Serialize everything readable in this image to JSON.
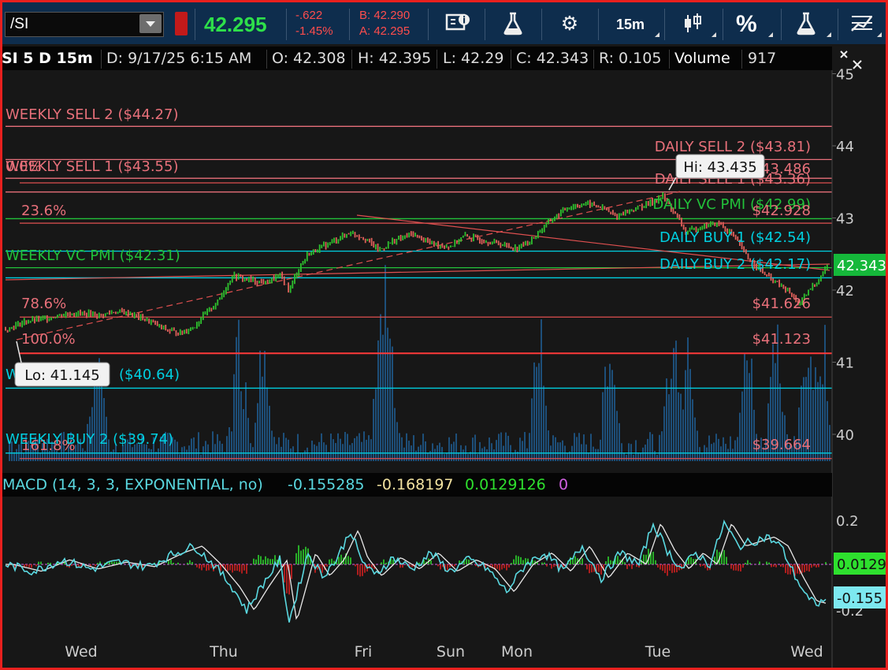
{
  "toolbar": {
    "symbol": "/SI",
    "last": "42.295",
    "change": "-.622",
    "change_pct": "-1.45%",
    "bid": "B: 42.290",
    "ask": "A: 42.295",
    "timeframe": "15m",
    "percent": "%",
    "icons": [
      "symbol-dropdown-icon",
      "link-icon",
      "info-icon",
      "flask-icon",
      "gear-icon",
      "timeframe",
      "candle-style-icon",
      "percent-icon",
      "flask-icon",
      "drawings-icon"
    ]
  },
  "infobar": {
    "symbol": "/SI 5 D 15m",
    "date": "D: 9/17/25 6:15 AM",
    "open": "O: 42.308",
    "high": "H: 42.395",
    "low": "L: 42.29",
    "close": "C: 42.343",
    "range": "R: 0.105",
    "volume_label": "Volume",
    "volume": "917"
  },
  "price_axis": {
    "ticks": [
      "45",
      "44",
      "43",
      "42",
      "41",
      "40"
    ],
    "current": "42.343"
  },
  "levels": {
    "weekly_sell_2": "WEEKLY SELL 2 ($44.27)",
    "weekly_sell_1": "WEEKLY SELL 1 ($43.55)",
    "weekly_vc_pmi": "WEEKLY VC PMI ($42.31)",
    "weekly_buy_1_partial": "W",
    "weekly_buy_1_value": "($40.64)",
    "weekly_buy_2": "WEEKLY BUY 2 ($39.74)",
    "daily_sell_2": "DAILY SELL 2 ($43.81)",
    "daily_sell_1": "DAILY SELL 1 ($43.36)",
    "daily_vc_pmi": "DAILY VC PMI ($42.99)",
    "daily_buy_1": "DAILY BUY 1 ($42.54)",
    "daily_buy_2": "DAILY BUY 2 ($42.17)"
  },
  "fib": {
    "f0": "0.0%",
    "f236": "23.6%",
    "f786": "78.6%",
    "f100": "100.0%",
    "f1618": "161.8%",
    "p0": "$43.486",
    "p236": "$42.928",
    "p786": "$41.626",
    "p100": "$41.123",
    "p1618": "$39.664"
  },
  "callouts": {
    "hi": "Hi: 43.435",
    "lo": "Lo: 41.145"
  },
  "macd": {
    "title": "MACD (14, 3, 3, EXPONENTIAL, no)",
    "value": "-0.155285",
    "avg": "-0.168197",
    "diff": "0.0129126",
    "zero": "0",
    "axis_ticks": [
      "0.2",
      "-0.2"
    ],
    "diff_tag": "0.0129",
    "value_tag": "-0.155"
  },
  "time_axis": [
    "Wed",
    "Thu",
    "Fri",
    "Sun",
    "Mon",
    "Tue",
    "Wed"
  ],
  "colors": {
    "up": "#2ec12e",
    "down": "#e0605a",
    "sell": "#e8707a",
    "buy": "#00cfe0",
    "pmi": "#22c23a",
    "macd": "#5ad8e0",
    "frame": "#e8201e"
  },
  "chart_data": {
    "type": "candlestick",
    "symbol": "/SI",
    "timeframe": "5 D 15m",
    "xlabel": "",
    "ylabel": "",
    "ylim": [
      39.6,
      45.0
    ],
    "x_ticks": [
      "Wed",
      "Thu",
      "Fri",
      "Sun",
      "Mon",
      "Tue",
      "Wed"
    ],
    "close_path": [
      [
        0,
        41.45
      ],
      [
        0.2,
        41.56
      ],
      [
        0.4,
        41.6
      ],
      [
        0.6,
        41.66
      ],
      [
        0.75,
        41.68
      ],
      [
        1.0,
        41.65
      ],
      [
        1.15,
        41.7
      ],
      [
        1.3,
        41.68
      ],
      [
        1.55,
        41.55
      ],
      [
        1.7,
        41.45
      ],
      [
        1.85,
        41.4
      ],
      [
        2.0,
        41.5
      ],
      [
        2.1,
        41.65
      ],
      [
        2.25,
        41.85
      ],
      [
        2.4,
        42.2
      ],
      [
        2.55,
        42.15
      ],
      [
        2.75,
        42.1
      ],
      [
        2.9,
        42.2
      ],
      [
        3.0,
        42.0
      ],
      [
        3.1,
        42.3
      ],
      [
        3.2,
        42.5
      ],
      [
        3.35,
        42.6
      ],
      [
        3.5,
        42.7
      ],
      [
        3.65,
        42.8
      ],
      [
        3.8,
        42.72
      ],
      [
        3.95,
        42.55
      ],
      [
        4.1,
        42.68
      ],
      [
        4.3,
        42.78
      ],
      [
        4.5,
        42.65
      ],
      [
        4.7,
        42.6
      ],
      [
        4.85,
        42.75
      ],
      [
        5.0,
        42.7
      ],
      [
        5.2,
        42.65
      ],
      [
        5.4,
        42.58
      ],
      [
        5.55,
        42.68
      ],
      [
        5.75,
        42.95
      ],
      [
        5.95,
        43.15
      ],
      [
        6.15,
        43.2
      ],
      [
        6.3,
        43.15
      ],
      [
        6.45,
        43.02
      ],
      [
        6.6,
        43.1
      ],
      [
        6.8,
        43.2
      ],
      [
        6.95,
        43.3
      ],
      [
        7.05,
        43.12
      ],
      [
        7.2,
        42.8
      ],
      [
        7.4,
        42.9
      ],
      [
        7.55,
        42.92
      ],
      [
        7.7,
        42.75
      ],
      [
        7.85,
        42.45
      ],
      [
        8.0,
        42.25
      ],
      [
        8.15,
        42.1
      ],
      [
        8.3,
        41.95
      ],
      [
        8.4,
        41.8
      ],
      [
        8.5,
        42.0
      ],
      [
        8.6,
        42.15
      ],
      [
        8.7,
        42.343
      ]
    ],
    "high": 43.435,
    "low": 41.145,
    "last": 42.343,
    "levels": [
      {
        "name": "WEEKLY SELL 2",
        "value": 44.27
      },
      {
        "name": "DAILY SELL 2",
        "value": 43.81
      },
      {
        "name": "WEEKLY SELL 1",
        "value": 43.55
      },
      {
        "name": "DAILY SELL 1",
        "value": 43.36
      },
      {
        "name": "DAILY VC PMI",
        "value": 42.99
      },
      {
        "name": "DAILY BUY 1",
        "value": 42.54
      },
      {
        "name": "WEEKLY VC PMI",
        "value": 42.31
      },
      {
        "name": "DAILY BUY 2",
        "value": 42.17
      },
      {
        "name": "WEEKLY BUY 1",
        "value": 40.64
      },
      {
        "name": "WEEKLY BUY 2",
        "value": 39.74
      }
    ],
    "fibonacci": [
      {
        "label": "0.0%",
        "value": 43.486
      },
      {
        "label": "23.6%",
        "value": 42.928
      },
      {
        "label": "78.6%",
        "value": 41.626
      },
      {
        "label": "100.0%",
        "value": 41.123
      },
      {
        "label": "161.8%",
        "value": 39.664
      }
    ],
    "macd": {
      "params": "14, 3, 3, EXPONENTIAL",
      "value": -0.155285,
      "avg": -0.168197,
      "diff": 0.0129126,
      "ylim": [
        -0.3,
        0.3
      ],
      "path": [
        [
          0,
          0.0
        ],
        [
          0.3,
          -0.03
        ],
        [
          0.6,
          0.02
        ],
        [
          0.9,
          -0.02
        ],
        [
          1.2,
          0.01
        ],
        [
          1.5,
          -0.01
        ],
        [
          1.8,
          0.05
        ],
        [
          2.0,
          0.08
        ],
        [
          2.2,
          0.0
        ],
        [
          2.4,
          -0.1
        ],
        [
          2.55,
          -0.2
        ],
        [
          2.7,
          -0.1
        ],
        [
          2.9,
          0.02
        ],
        [
          3.0,
          -0.25
        ],
        [
          3.1,
          -0.1
        ],
        [
          3.2,
          0.05
        ],
        [
          3.35,
          -0.05
        ],
        [
          3.5,
          0.02
        ],
        [
          3.65,
          0.15
        ],
        [
          3.75,
          0.03
        ],
        [
          3.9,
          -0.05
        ],
        [
          4.1,
          0.03
        ],
        [
          4.3,
          -0.02
        ],
        [
          4.5,
          0.05
        ],
        [
          4.7,
          -0.03
        ],
        [
          4.9,
          0.02
        ],
        [
          5.1,
          -0.02
        ],
        [
          5.3,
          -0.12
        ],
        [
          5.5,
          0.0
        ],
        [
          5.7,
          0.05
        ],
        [
          5.9,
          -0.03
        ],
        [
          6.1,
          0.08
        ],
        [
          6.3,
          -0.06
        ],
        [
          6.5,
          0.05
        ],
        [
          6.7,
          0.0
        ],
        [
          6.85,
          0.18
        ],
        [
          7.0,
          0.06
        ],
        [
          7.15,
          -0.02
        ],
        [
          7.3,
          0.05
        ],
        [
          7.45,
          0.0
        ],
        [
          7.6,
          0.18
        ],
        [
          7.75,
          0.08
        ],
        [
          7.9,
          0.1
        ],
        [
          8.05,
          0.12
        ],
        [
          8.2,
          0.08
        ],
        [
          8.35,
          -0.05
        ],
        [
          8.5,
          -0.16
        ],
        [
          8.6,
          -0.17
        ],
        [
          8.7,
          -0.155
        ]
      ]
    }
  }
}
